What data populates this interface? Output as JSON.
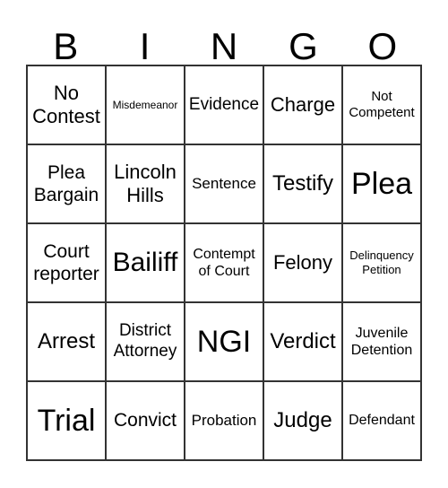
{
  "header": [
    "B",
    "I",
    "N",
    "G",
    "O"
  ],
  "cells": [
    [
      "No\nContest",
      "Misdemeanor",
      "Evidence",
      "Charge",
      "Not\nCompetent"
    ],
    [
      "Plea\nBargain",
      "Lincoln\nHills",
      "Sentence",
      "Testify",
      "Plea"
    ],
    [
      "Court\nreporter",
      "Bailiff",
      "Contempt\nof Court",
      "Felony",
      "Delinquency\nPetition"
    ],
    [
      "Arrest",
      "District\nAttorney",
      "NGI",
      "Verdict",
      "Juvenile\nDetention"
    ],
    [
      "Trial",
      "Convict",
      "Probation",
      "Judge",
      "Defendant"
    ]
  ]
}
